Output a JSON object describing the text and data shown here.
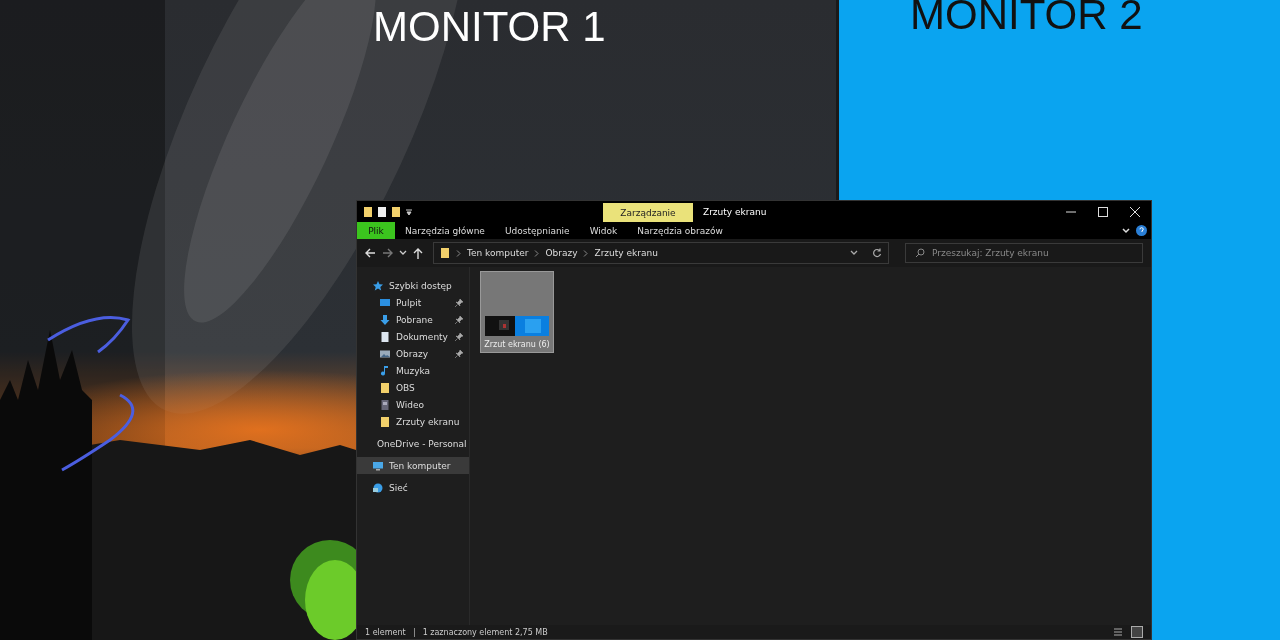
{
  "monitors": [
    {
      "label": "MONITOR 1"
    },
    {
      "label": "MONITOR 2"
    }
  ],
  "window": {
    "context_tab": "Zarządzanie",
    "title": "Zrzuty ekranu",
    "ribbon_tabs": [
      {
        "label": "Plik",
        "kind": "file",
        "selected": false
      },
      {
        "label": "Narzędzia główne",
        "kind": "tab",
        "selected": false
      },
      {
        "label": "Udostępnianie",
        "kind": "tab",
        "selected": false
      },
      {
        "label": "Widok",
        "kind": "tab",
        "selected": false
      },
      {
        "label": "Narzędzia obrazów",
        "kind": "tab",
        "selected": false
      }
    ],
    "breadcrumbs": [
      "Ten komputer",
      "Obrazy",
      "Zrzuty ekranu"
    ],
    "search": {
      "placeholder": "Przeszukaj: Zrzuty ekranu"
    },
    "sidebar": [
      {
        "label": "Szybki dostęp",
        "kind": "star",
        "selected": false,
        "children": [
          {
            "label": "Pulpit",
            "kind": "desktop",
            "pinned": true,
            "selected": false
          },
          {
            "label": "Pobrane",
            "kind": "download",
            "pinned": true,
            "selected": false
          },
          {
            "label": "Dokumenty",
            "kind": "document",
            "pinned": true,
            "selected": false
          },
          {
            "label": "Obrazy",
            "kind": "pictures",
            "pinned": true,
            "selected": false
          },
          {
            "label": "Muzyka",
            "kind": "music",
            "pinned": false,
            "selected": false
          },
          {
            "label": "OBS",
            "kind": "folder",
            "pinned": false,
            "selected": false
          },
          {
            "label": "Wideo",
            "kind": "video",
            "pinned": false,
            "selected": false
          },
          {
            "label": "Zrzuty ekranu",
            "kind": "folder",
            "pinned": false,
            "selected": false
          }
        ]
      },
      {
        "label": "OneDrive - Personal",
        "kind": "cloud",
        "selected": false
      },
      {
        "label": "Ten komputer",
        "kind": "computer",
        "selected": true
      },
      {
        "label": "Sieć",
        "kind": "network",
        "selected": false
      }
    ],
    "files": [
      {
        "name": "Zrzut ekranu (6)",
        "selected": true
      }
    ],
    "status_bar": [
      "1 element",
      "1 zaznaczony element  2,75 MB"
    ]
  }
}
